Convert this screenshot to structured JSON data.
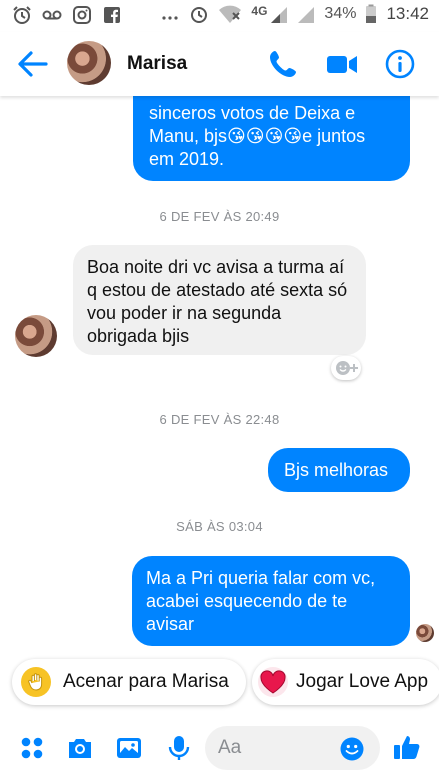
{
  "status_bar": {
    "network": "4G",
    "battery": "34%",
    "time": "13:42"
  },
  "header": {
    "contact_name": "Marisa"
  },
  "messages": {
    "m1_text": "sinceros votos de Deixa e Manu, bjs😘😘😘😘e juntos em 2019.",
    "stamp1": "6 DE FEV ÀS 20:49",
    "m2_text": "Boa noite dri vc avisa a turma aí q estou de atestado até sexta só vou poder ir na segunda obrigada bjis",
    "stamp2": "6 DE FEV ÀS 22:48",
    "m3_text": "Bjs melhoras",
    "stamp3": "SÁB ÀS 03:04",
    "m4_text": "Ma a Pri queria falar com vc, acabei esquecendo de te avisar"
  },
  "quick_replies": {
    "wave_label": "Acenar para Marisa",
    "love_label": "Jogar Love App"
  },
  "composer": {
    "placeholder": "Aa"
  },
  "colors": {
    "accent": "#0084ff",
    "incoming_bubble": "#f0f0f0",
    "timestamp": "#8a8d91"
  },
  "icons": [
    "alarm-icon",
    "voicemail-icon",
    "instagram-icon",
    "facebook-icon",
    "more-dots-icon",
    "wifi-icon",
    "signal-icon",
    "battery-icon",
    "back-arrow-icon",
    "phone-icon",
    "video-icon",
    "info-icon",
    "wave-icon",
    "heart-icon",
    "apps-grid-icon",
    "camera-icon",
    "image-icon",
    "microphone-icon",
    "emoji-icon",
    "thumbs-up-icon"
  ]
}
